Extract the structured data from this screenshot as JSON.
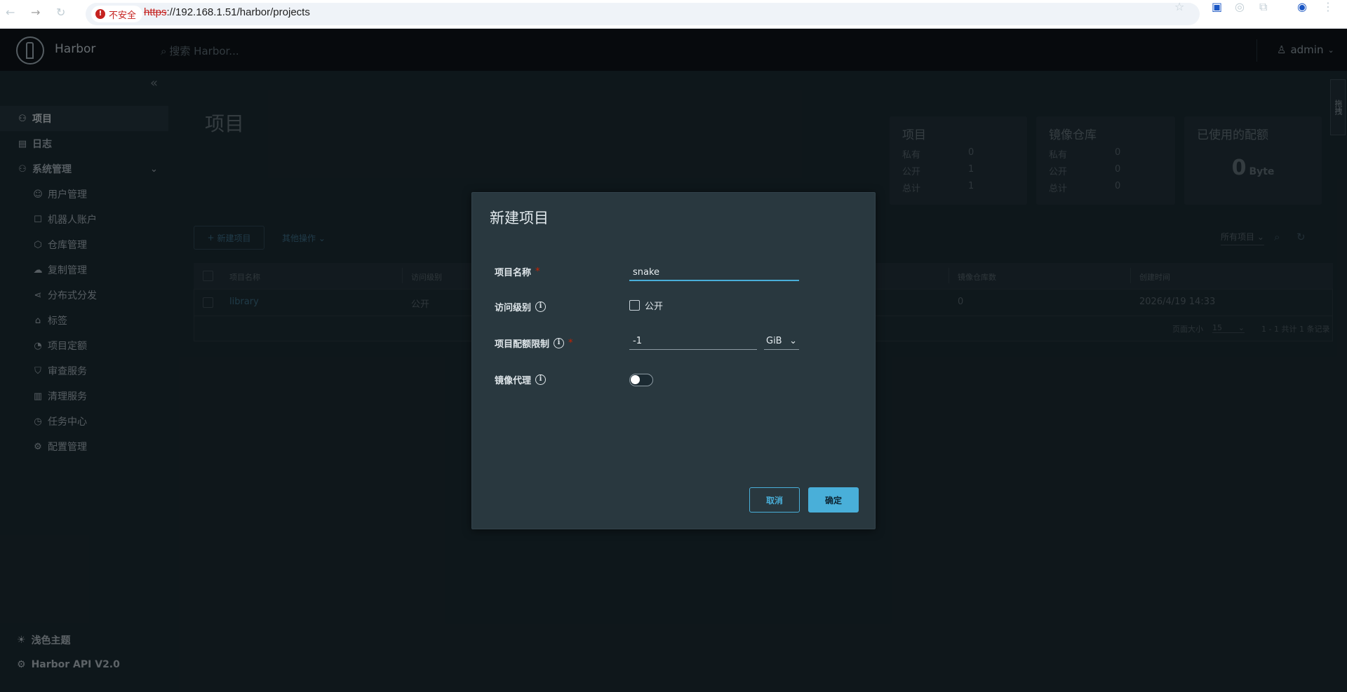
{
  "browser": {
    "security_label": "不安全",
    "url_scheme": "https",
    "url_rest": "://192.168.1.51/harbor/projects"
  },
  "header": {
    "brand": "Harbor",
    "search_placeholder": "搜索 Harbor...",
    "user": "admin"
  },
  "sidebar": {
    "items": [
      {
        "label": "项目",
        "icon": "projects-icon",
        "active": true
      },
      {
        "label": "日志",
        "icon": "logs-icon"
      },
      {
        "label": "系统管理",
        "icon": "admin-icon"
      },
      {
        "label": "用户管理",
        "icon": "users-icon"
      },
      {
        "label": "机器人账户",
        "icon": "robot-icon"
      },
      {
        "label": "仓库管理",
        "icon": "registry-icon"
      },
      {
        "label": "复制管理",
        "icon": "replication-icon"
      },
      {
        "label": "分布式分发",
        "icon": "distribution-icon"
      },
      {
        "label": "标签",
        "icon": "tag-icon"
      },
      {
        "label": "项目定额",
        "icon": "quota-icon"
      },
      {
        "label": "审查服务",
        "icon": "shield-icon"
      },
      {
        "label": "清理服务",
        "icon": "trash-icon"
      },
      {
        "label": "任务中心",
        "icon": "job-icon"
      },
      {
        "label": "配置管理",
        "icon": "gear-icon"
      }
    ],
    "theme_toggle": "浅色主题",
    "api_link": "Harbor API V2.0"
  },
  "page": {
    "title": "项目",
    "new_project": "新建项目",
    "other_actions": "其他操作",
    "filter": "所有项目",
    "side_tab": "拖拽"
  },
  "stats": {
    "projects": {
      "title": "项目",
      "rows": [
        {
          "label": "私有",
          "value": "0"
        },
        {
          "label": "公开",
          "value": "1"
        },
        {
          "label": "总计",
          "value": "1"
        }
      ]
    },
    "repos": {
      "title": "镜像仓库",
      "rows": [
        {
          "label": "私有",
          "value": "0"
        },
        {
          "label": "公开",
          "value": "0"
        },
        {
          "label": "总计",
          "value": "0"
        }
      ]
    },
    "quota": {
      "title": "已使用的配额",
      "value": "0",
      "unit": "Byte"
    }
  },
  "grid": {
    "headers": {
      "name": "项目名称",
      "access": "访问级别",
      "repo_count": "镜像仓库数",
      "created": "创建时间"
    },
    "rows": [
      {
        "name": "library",
        "access": "公开",
        "repo_count": "0",
        "created": "2026/4/19 14:33"
      }
    ],
    "page_size_label": "页面大小",
    "page_size": "15",
    "summary": "1 - 1 共计 1 条记录"
  },
  "modal": {
    "title": "新建项目",
    "name_label": "项目名称",
    "name_value": "snake",
    "access_label": "访问级别",
    "public_label": "公开",
    "quota_label": "项目配额限制",
    "quota_value": "-1",
    "quota_unit": "GiB",
    "proxy_label": "镜像代理",
    "cancel": "取消",
    "ok": "确定"
  }
}
